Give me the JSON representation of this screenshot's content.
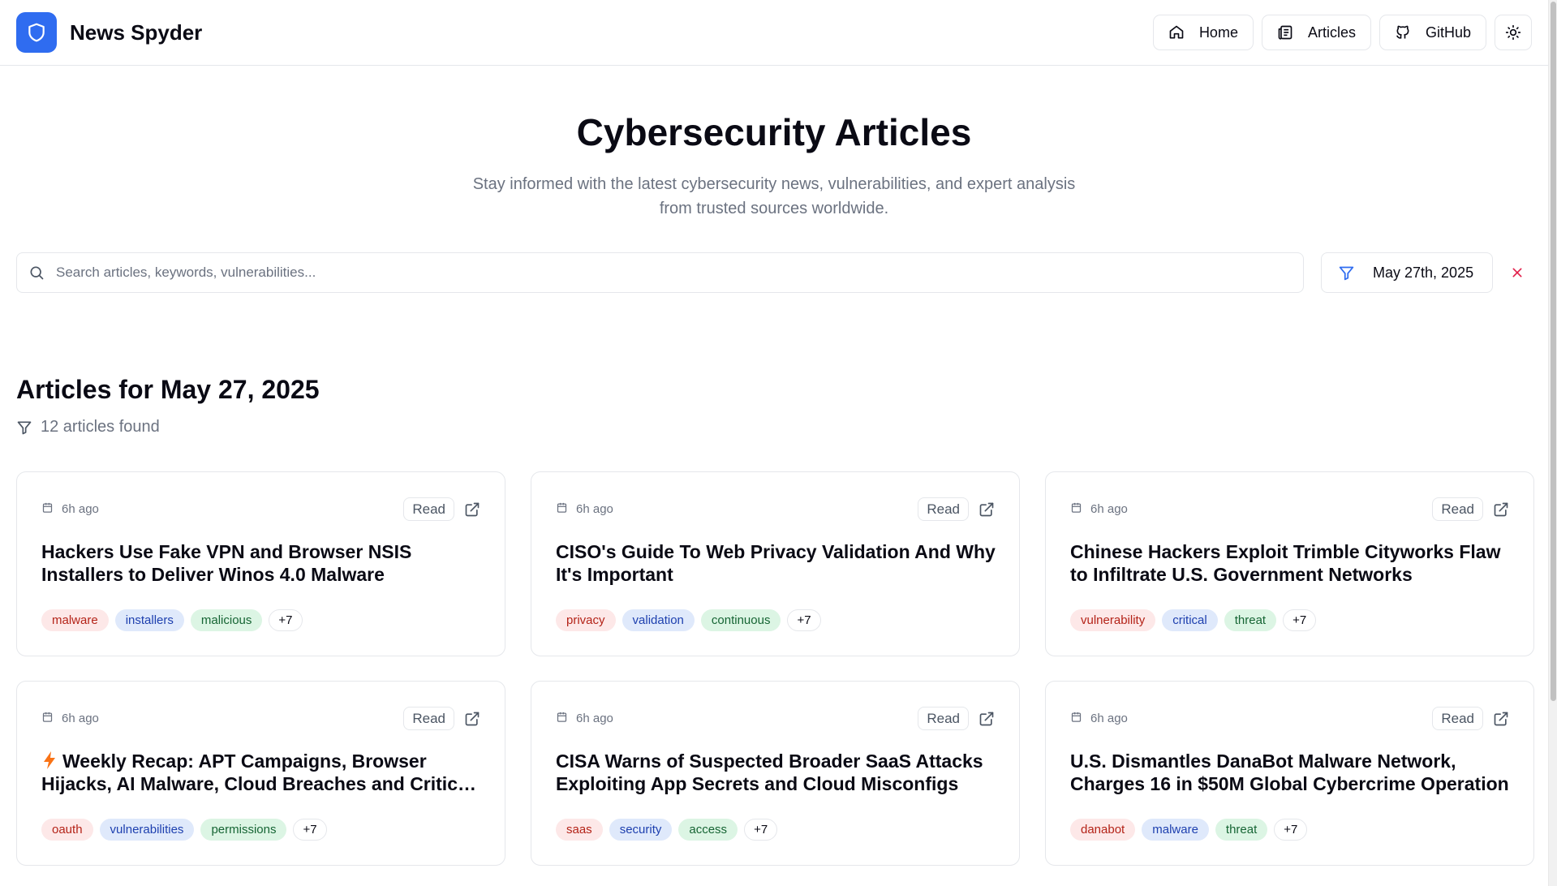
{
  "app": {
    "name": "News Spyder"
  },
  "nav": {
    "home": "Home",
    "articles": "Articles",
    "github": "GitHub"
  },
  "hero": {
    "title": "Cybersecurity Articles",
    "subtitle_line1": "Stay informed with the latest cybersecurity news, vulnerabilities, and expert analysis",
    "subtitle_line2": "from trusted sources worldwide."
  },
  "search": {
    "placeholder": "Search articles, keywords, vulnerabilities...",
    "value": ""
  },
  "filter": {
    "date": "May 27th, 2025"
  },
  "section": {
    "title": "Articles for May 27, 2025",
    "count_text": "12 articles found"
  },
  "articles": [
    {
      "time": "6h ago",
      "read": "Read",
      "title": "Hackers Use Fake VPN and Browser NSIS Installers to Deliver Winos 4.0 Malware",
      "tags": [
        "malware",
        "installers",
        "malicious"
      ],
      "more": "+7"
    },
    {
      "time": "6h ago",
      "read": "Read",
      "title": "CISO's Guide To Web Privacy Validation And Why It's Important",
      "tags": [
        "privacy",
        "validation",
        "continuous"
      ],
      "more": "+7"
    },
    {
      "time": "6h ago",
      "read": "Read",
      "title": "Chinese Hackers Exploit Trimble Cityworks Flaw to Infiltrate U.S. Government Networks",
      "tags": [
        "vulnerability",
        "critical",
        "threat"
      ],
      "more": "+7"
    },
    {
      "time": "6h ago",
      "read": "Read",
      "title": "Weekly Recap: APT Campaigns, Browser Hijacks, AI Malware, Cloud Breaches and Critical CVEs",
      "tags": [
        "oauth",
        "vulnerabilities",
        "permissions"
      ],
      "more": "+7"
    },
    {
      "time": "6h ago",
      "read": "Read",
      "title": "CISA Warns of Suspected Broader SaaS Attacks Exploiting App Secrets and Cloud Misconfigs",
      "tags": [
        "saas",
        "security",
        "access"
      ],
      "more": "+7"
    },
    {
      "time": "6h ago",
      "read": "Read",
      "title": "U.S. Dismantles DanaBot Malware Network, Charges 16 in $50M Global Cybercrime Operation",
      "tags": [
        "danabot",
        "malware",
        "threat"
      ],
      "more": "+7"
    }
  ],
  "colors": {
    "brand": "#2f6cf0",
    "tag_red": "#fde8e8",
    "tag_blue": "#dfe9fb",
    "tag_green": "#dcf5e4",
    "clear": "#e11d48"
  }
}
